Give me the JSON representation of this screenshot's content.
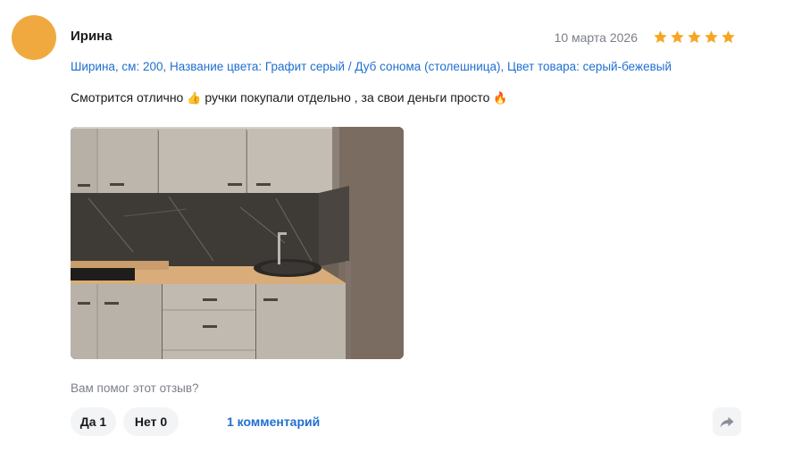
{
  "review": {
    "author": "Ирина",
    "date": "10 марта 2026",
    "rating": 5,
    "rating_max": 5,
    "properties": "Ширина, см: 200, Название цвета: Графит серый / Дуб сонома (столешница), Цвет товара: серый-бежевый",
    "text_part1": "Смотрится отлично",
    "emoji1": "👍",
    "text_part2": "ручки покупали отдельно , за свои деньги просто",
    "emoji2": "🔥",
    "avatar_color": "#efa93e",
    "star_color": "#f6a623",
    "link_color": "#1f6fd0"
  },
  "feedback": {
    "question": "Вам помог этот отзыв?",
    "yes_label": "Да 1",
    "no_label": "Нет 0",
    "comments_label": "1 комментарий",
    "share_icon": "share-arrow-icon"
  }
}
